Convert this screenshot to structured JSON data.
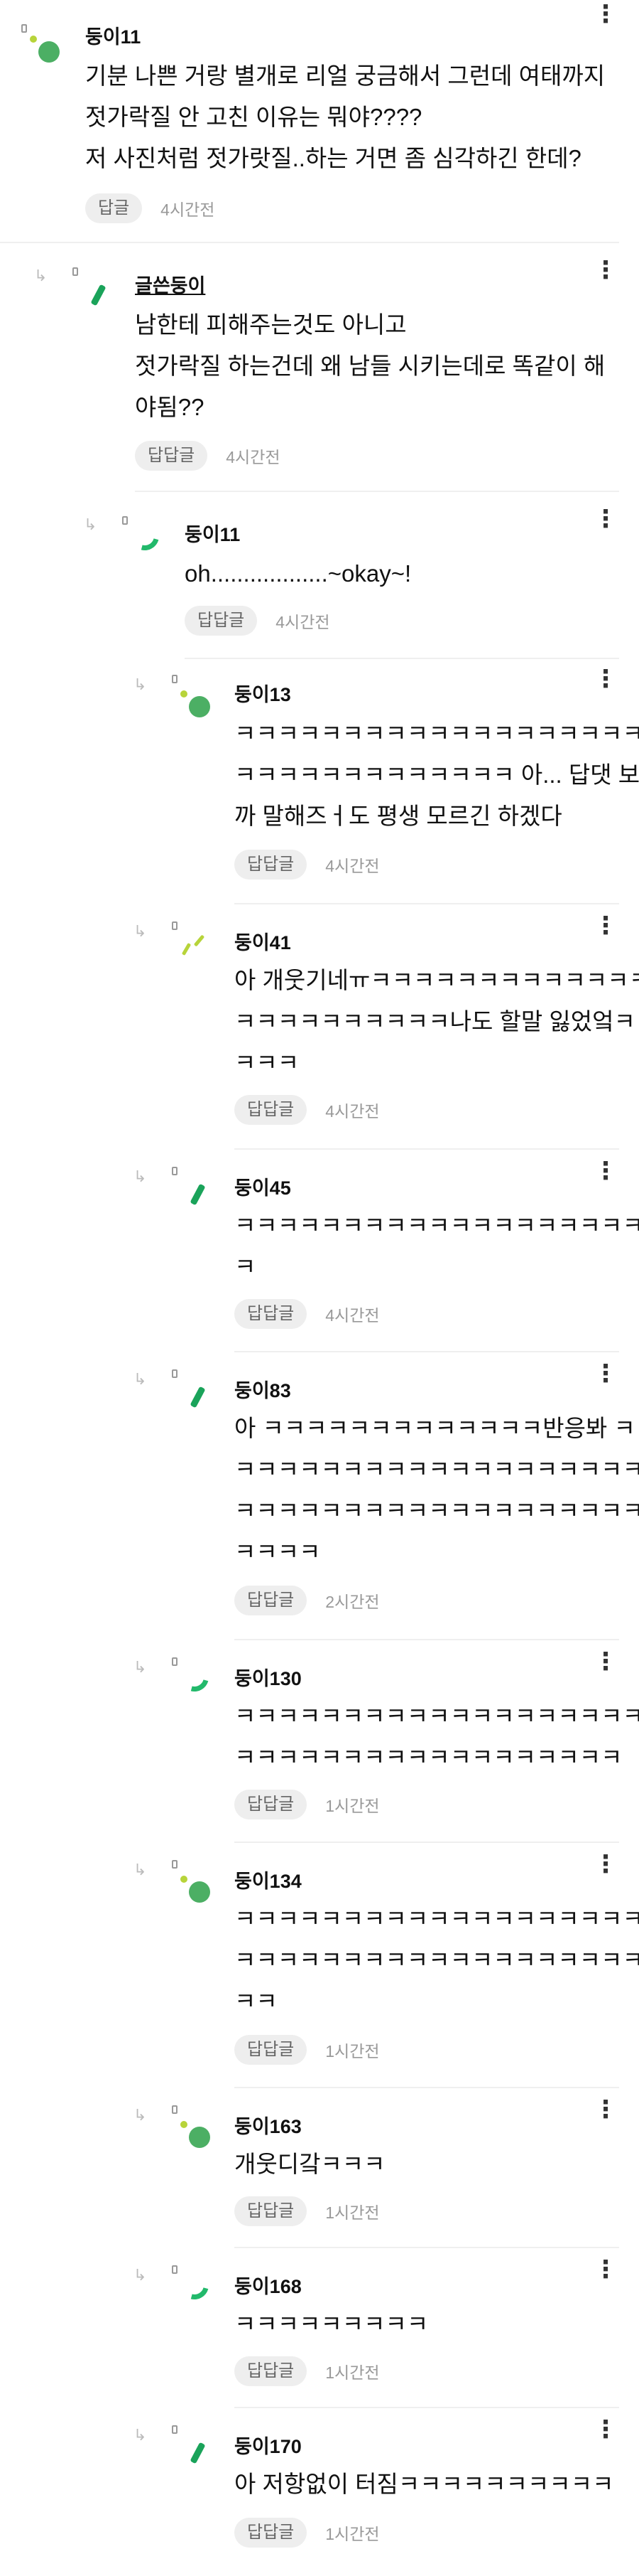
{
  "comments": [
    {
      "name": "둥이11",
      "lines": [
        "기분 나쁜 거랑 별개로 리얼 궁금해서 그런데 여태까지",
        "젓가락질 안 고친 이유는 뭐야????",
        "저 사진처럼 젓가랏질..하는 거면 좀 심각하긴 한데?"
      ],
      "action": "답글",
      "time": "4시간전"
    },
    {
      "name": "글쓴둥이",
      "lines": [
        "남한테 피해주는것도 아니고",
        "젓가락질 하는건데 왜 남들 시키는데로 똑같이 해",
        "야됨??"
      ],
      "action": "답답글",
      "time": "4시간전"
    },
    {
      "name": "둥이11",
      "lines": [
        "oh..................~okay~!"
      ],
      "action": "답답글",
      "time": "4시간전"
    },
    {
      "name": "둥이13",
      "lines": [
        "ㅋㅋㅋㅋㅋㅋㅋㅋㅋㅋㅋㅋㅋㅋㅋㅋㅋㅋㅋㅋ",
        "ㅋㅋㅋㅋㅋㅋㅋㅋㅋㅋㅋㅋㅋ 아... 답댓 보니",
        "까 말해즈ㅓ도 평생 모르긴 하겠다"
      ],
      "action": "답답글",
      "time": "4시간전"
    },
    {
      "name": "둥이41",
      "lines": [
        "아 개웃기네ㅠㅋㅋㅋㅋㅋㅋㅋㅋㅋㅋㅋㅋㅋ",
        "ㅋㅋㅋㅋㅋㅋㅋㅋㅋㅋ나도 할말 잃었엌ㅋ",
        "ㅋㅋㅋ"
      ],
      "action": "답답글",
      "time": "4시간전"
    },
    {
      "name": "둥이45",
      "lines": [
        "ㅋㅋㅋㅋㅋㅋㅋㅋㅋㅋㅋㅋㅋㅋㅋㅋㅋㅋㅋㅋ",
        "ㅋ"
      ],
      "action": "답답글",
      "time": "4시간전"
    },
    {
      "name": "둥이83",
      "lines": [
        "아 ㅋㅋㅋㅋㅋㅋㅋㅋㅋㅋㅋㅋㅋ반응봐 ㅋ",
        "ㅋㅋㅋㅋㅋㅋㅋㅋㅋㅋㅋㅋㅋㅋㅋㅋㅋㅋㅋㅋ",
        "ㅋㅋㅋㅋㅋㅋㅋㅋㅋㅋㅋㅋㅋㅋㅋㅋㅋㅋㅋㅋ",
        "ㅋㅋㅋㅋ"
      ],
      "action": "답답글",
      "time": "2시간전"
    },
    {
      "name": "둥이130",
      "lines": [
        "ㅋㅋㅋㅋㅋㅋㅋㅋㅋㅋㅋㅋㅋㅋㅋㅋㅋㅋㅋㅋ",
        "ㅋㅋㅋㅋㅋㅋㅋㅋㅋㅋㅋㅋㅋㅋㅋㅋㅋㅋ"
      ],
      "action": "답답글",
      "time": "1시간전"
    },
    {
      "name": "둥이134",
      "lines": [
        "ㅋㅋㅋㅋㅋㅋㅋㅋㅋㅋㅋㅋㅋㅋㅋㅋㅋㅋㅋㅋ",
        "ㅋㅋㅋㅋㅋㅋㅋㅋㅋㅋㅋㅋㅋㅋㅋㅋㅋㅋㅋㅋ",
        "ㅋㅋ"
      ],
      "action": "답답글",
      "time": "1시간전"
    },
    {
      "name": "둥이163",
      "lines": [
        "개웃디갘ㅋㅋㅋ"
      ],
      "action": "답답글",
      "time": "1시간전"
    },
    {
      "name": "둥이168",
      "lines": [
        "ㅋㅋㅋㅋㅋㅋㅋㅋㅋ"
      ],
      "action": "답답글",
      "time": "1시간전"
    },
    {
      "name": "둥이170",
      "lines": [
        "아 저항없이 터짐ㅋㅋㅋㅋㅋㅋㅋㅋㅋㅋ"
      ],
      "action": "답답글",
      "time": "1시간전"
    }
  ],
  "icons": {
    "more": "more-dots-icon",
    "reply_arrow": "reply-arrow-icon"
  },
  "colors": {
    "avatar_green": "#4caf64",
    "avatar_lime": "#b7d43a",
    "avatar_stroke": "#1aa35a",
    "pill_bg": "#eeeeee",
    "time": "#999999",
    "separator": "#efefef"
  }
}
